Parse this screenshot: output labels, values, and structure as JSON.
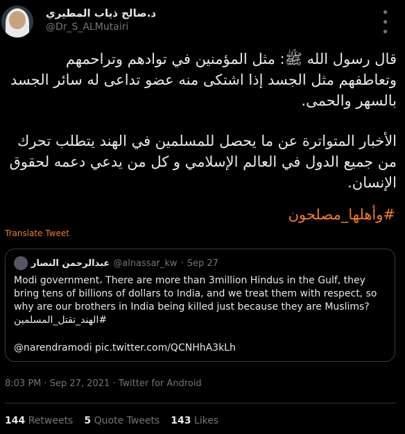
{
  "author": {
    "name": "د.صالح ذياب المطيري",
    "handle": "@Dr_S_ALMutairi"
  },
  "more_icon": "ellipsis-icon",
  "tweet": {
    "paragraph1": "قال رسول الله ﷺ: مثل المؤمنين في توادهم وتراحمهم وتعاطفهم مثل الجسد إذا اشتكى منه عضو تداعى له سائر الجسد بالسهر والحمى.",
    "paragraph2": "الأخبار المتواترة عن ما يحصل للمسلمين في الهند يتطلب تحرك من جميع الدول في العالم الإسلامي و كل من يدعي دعمه لحقوق الإنسان.",
    "hashtag": "#وأهلها_مصلحون"
  },
  "translate_label": "Translate Tweet",
  "quote": {
    "name": "عبدالرحمن النصار",
    "handle": "@alnassar_kw",
    "sep": "·",
    "date": "Sep 27",
    "text": "Modi government، There are more than 3million Hindus in the Gulf, they bring tens of billions of dollars to India, and we treat them with respect, so why are our brothers in India being killed just because they are Muslims?",
    "tag": "#الهند_تقتل_المسلمين",
    "links": "@narendramodi pic.twitter.com/QCNHhA3kLh"
  },
  "meta": "8:03 PM · Sep 27, 2021 · Twitter for Android",
  "stats": {
    "retweets_count": "144",
    "retweets_label": "Retweets",
    "quotes_count": "5",
    "quotes_label": "Quote Tweets",
    "likes_count": "143",
    "likes_label": "Likes"
  },
  "colors": {
    "accent": "#f47b22",
    "background": "#000000",
    "secondary_text": "#71767b"
  }
}
